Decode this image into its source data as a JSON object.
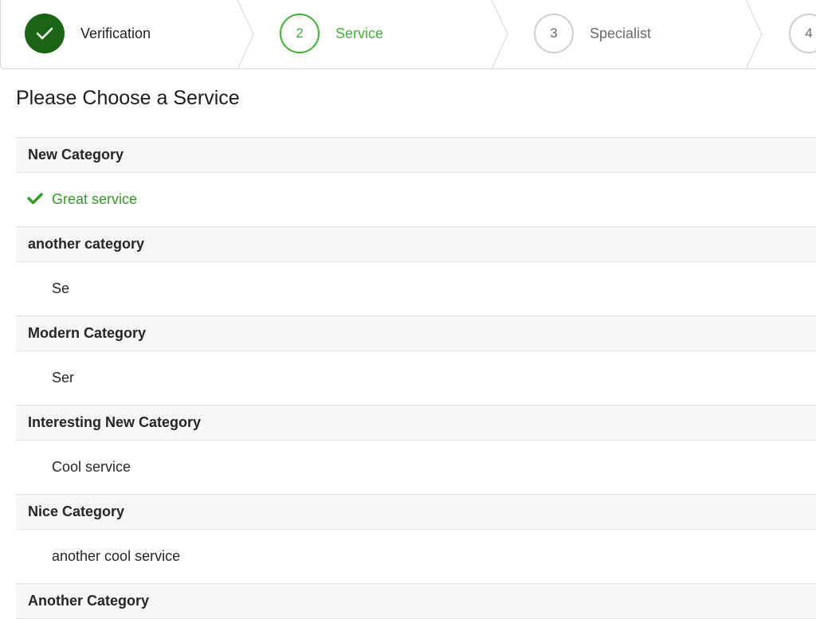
{
  "stepper": {
    "steps": [
      {
        "number": "",
        "label": "Verification",
        "state": "done",
        "icon": "check-icon"
      },
      {
        "number": "2",
        "label": "Service",
        "state": "active"
      },
      {
        "number": "3",
        "label": "Specialist",
        "state": "todo"
      },
      {
        "number": "4",
        "label": "",
        "state": "todo"
      }
    ]
  },
  "page": {
    "title": "Please Choose a Service"
  },
  "categories": [
    {
      "name": "New Category",
      "services": [
        {
          "name": "Great service",
          "selected": true,
          "icon": "check-icon"
        }
      ]
    },
    {
      "name": "another category",
      "services": [
        {
          "name": "Se",
          "selected": false
        }
      ]
    },
    {
      "name": "Modern Category",
      "services": [
        {
          "name": "Ser",
          "selected": false
        }
      ]
    },
    {
      "name": "Interesting New Category",
      "services": [
        {
          "name": "Cool service",
          "selected": false
        }
      ]
    },
    {
      "name": "Nice Category",
      "services": [
        {
          "name": "another cool service",
          "selected": false
        }
      ]
    },
    {
      "name": "Another Category",
      "services": []
    }
  ],
  "colors": {
    "accent": "#3fb232",
    "done": "#1b6414",
    "selected_text": "#2f9a24",
    "muted": "#6b6b6b"
  }
}
